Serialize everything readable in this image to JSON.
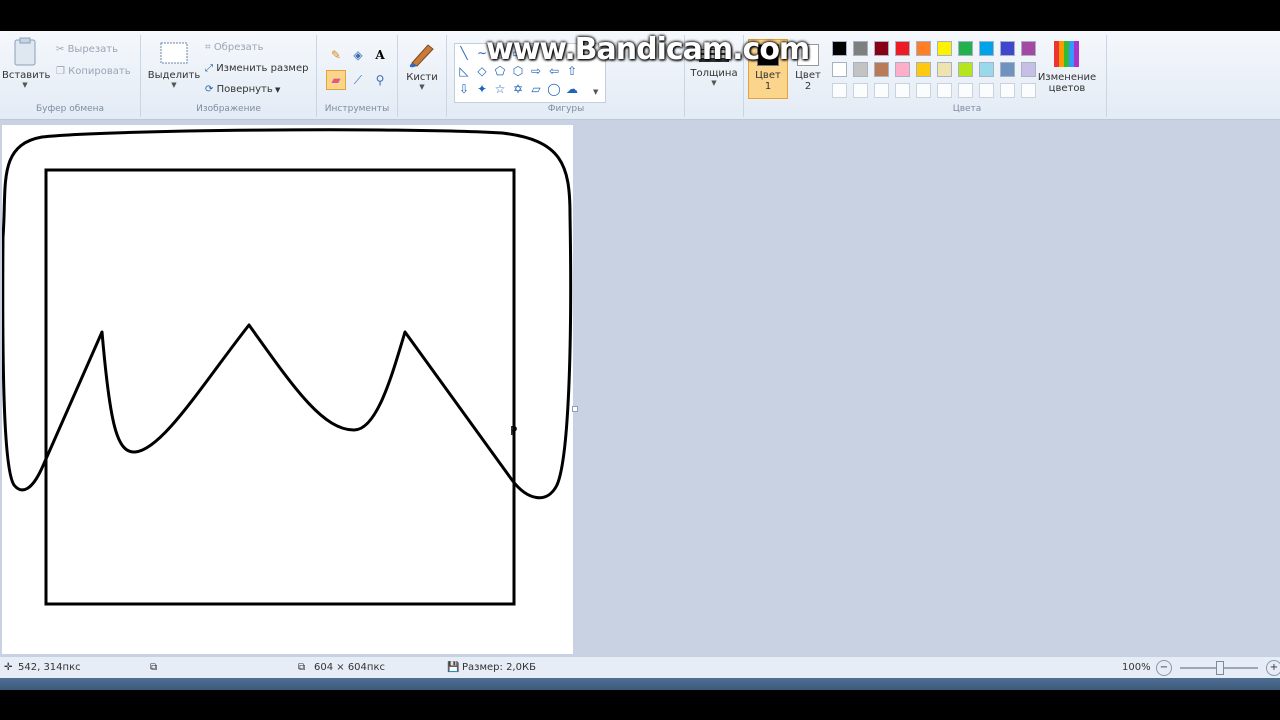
{
  "watermark": "www.Bandicam.com",
  "ribbon": {
    "clipboard": {
      "paste": "Вставить",
      "cut": "Вырезать",
      "copy": "Копировать",
      "label": "Буфер обмена"
    },
    "image": {
      "select": "Выделить",
      "crop": "Обрезать",
      "resize": "Изменить размер",
      "rotate": "Повернуть",
      "label": "Изображение"
    },
    "tools": {
      "label": "Инструменты"
    },
    "brushes": {
      "label": "Кисти"
    },
    "shapes": {
      "label": "Фигуры"
    },
    "size": {
      "label": "Толщина"
    },
    "color1": {
      "label": "Цвет",
      "num": "1"
    },
    "color2": {
      "label": "Цвет",
      "num": "2"
    },
    "colors": {
      "label": "Цвета",
      "edit_label_1": "Изменение",
      "edit_label_2": "цветов",
      "row1": [
        "#000000",
        "#7f7f7f",
        "#880015",
        "#ed1c24",
        "#ff7f27",
        "#fff200",
        "#22b14c",
        "#00a2e8",
        "#3f48cc",
        "#a349a4"
      ],
      "row2": [
        "#ffffff",
        "#c3c3c3",
        "#b97a57",
        "#ffaec9",
        "#ffc90e",
        "#efe4b0",
        "#b5e61d",
        "#99d9ea",
        "#7092be",
        "#c8bfe7"
      ]
    }
  },
  "status": {
    "cursor_pos": "542, 314пкс",
    "image_size": "604 × 604пкс",
    "file_size": "Размер: 2,0КБ",
    "zoom": "100%"
  }
}
